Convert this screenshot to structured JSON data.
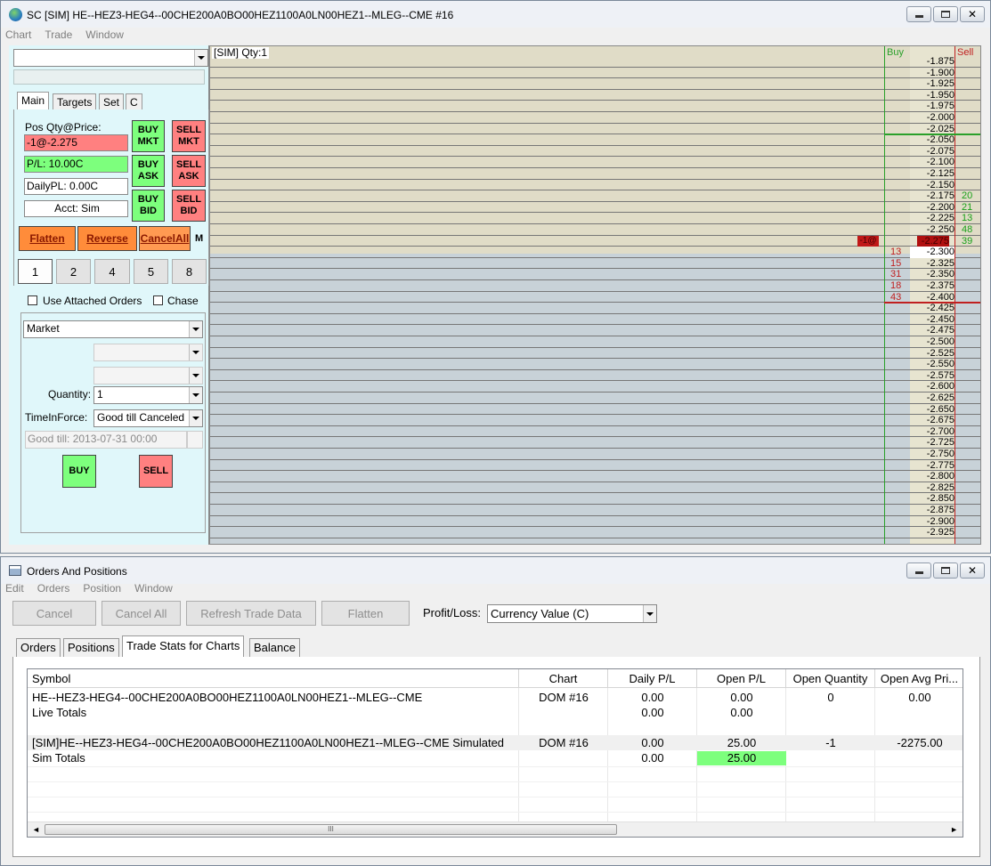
{
  "top_window": {
    "title": "SC [SIM] HE--HEZ3-HEG4--00CHE200A0BO00HEZ1100A0LN00HEZ1--MLEG--CME  #16",
    "menu": [
      "Chart",
      "Trade",
      "Window"
    ]
  },
  "trade_panel": {
    "tabs": [
      "Main",
      "Targets",
      "Set",
      "C"
    ],
    "pos_label": "Pos Qty@Price:",
    "pos_value": "-1@-2.275",
    "pl_value": "P/L: 10.00C",
    "daily_pl": "DailyPL: 0.00C",
    "acct": "Acct: Sim",
    "buy_mkt": "BUY MKT",
    "sell_mkt": "SELL MKT",
    "buy_ask": "BUY ASK",
    "sell_ask": "SELL ASK",
    "buy_bid": "BUY BID",
    "sell_bid": "SELL BID",
    "flatten": "Flatten",
    "reverse": "Reverse",
    "cancel_all": "CancelAll",
    "m_label": "M",
    "qty_buttons": [
      "1",
      "2",
      "4",
      "5",
      "8"
    ],
    "use_attached": "Use Attached Orders",
    "chase": "Chase",
    "order_type": "Market",
    "quantity_label": "Quantity:",
    "quantity": "1",
    "tif_label": "TimeInForce:",
    "tif": "Good till Canceled",
    "good_till": "Good till: 2013-07-31 00:00",
    "buy": "BUY",
    "sell": "SELL"
  },
  "dom": {
    "header": "[SIM]  Qty:1",
    "buy_header": "Buy",
    "sell_header": "Sell",
    "prices": [
      "-1.875",
      "-1.900",
      "-1.925",
      "-1.950",
      "-1.975",
      "-2.000",
      "-2.025",
      "-2.050",
      "-2.075",
      "-2.100",
      "-2.125",
      "-2.150",
      "-2.175",
      "-2.200",
      "-2.225",
      "-2.250",
      "-2.275",
      "-2.300",
      "-2.325",
      "-2.350",
      "-2.375",
      "-2.400",
      "-2.425",
      "-2.450",
      "-2.475",
      "-2.500",
      "-2.525",
      "-2.550",
      "-2.575",
      "-2.600",
      "-2.625",
      "-2.650",
      "-2.675",
      "-2.700",
      "-2.725",
      "-2.750",
      "-2.775",
      "-2.800",
      "-2.825",
      "-2.850",
      "-2.875",
      "-2.900",
      "-2.925"
    ],
    "ask_sizes": [
      {
        "row": 12,
        "v": "20"
      },
      {
        "row": 13,
        "v": "21"
      },
      {
        "row": 14,
        "v": "13"
      },
      {
        "row": 15,
        "v": "48"
      },
      {
        "row": 16,
        "v": "39"
      }
    ],
    "bid_sizes": [
      {
        "row": 17,
        "v": "13"
      },
      {
        "row": 18,
        "v": "15"
      },
      {
        "row": 19,
        "v": "31"
      },
      {
        "row": 20,
        "v": "18"
      },
      {
        "row": 21,
        "v": "43"
      }
    ],
    "position_marker": "-1@",
    "position_row": 16,
    "current_row": 17
  },
  "bottom_window": {
    "title": "Orders And Positions",
    "menu": [
      "Edit",
      "Orders",
      "Position",
      "Window"
    ],
    "buttons": [
      "Cancel",
      "Cancel All",
      "Refresh Trade Data",
      "Flatten"
    ],
    "pl_label": "Profit/Loss:",
    "pl_select": "Currency Value (C)",
    "tabs": [
      "Orders",
      "Positions",
      "Trade Stats for Charts",
      "Balance"
    ],
    "columns": [
      "Symbol",
      "Chart",
      "Daily P/L",
      "Open P/L",
      "Open Quantity",
      "Open Avg Pri..."
    ],
    "rows": [
      [
        "HE--HEZ3-HEG4--00CHE200A0BO00HEZ1100A0LN00HEZ1--MLEG--CME",
        "DOM #16",
        "0.00",
        "0.00",
        "0",
        "0.00"
      ],
      [
        "Live Totals",
        "",
        "0.00",
        "0.00",
        "",
        ""
      ],
      [
        "",
        "",
        "",
        "",
        "",
        ""
      ],
      [
        "[SIM]HE--HEZ3-HEG4--00CHE200A0BO00HEZ1100A0LN00HEZ1--MLEG--CME Simulated",
        "DOM  #16",
        "0.00",
        "25.00",
        "-1",
        "-2275.00"
      ],
      [
        " Sim Totals",
        "",
        "0.00",
        "25.00",
        "",
        ""
      ]
    ],
    "scroll_grip": "III"
  }
}
